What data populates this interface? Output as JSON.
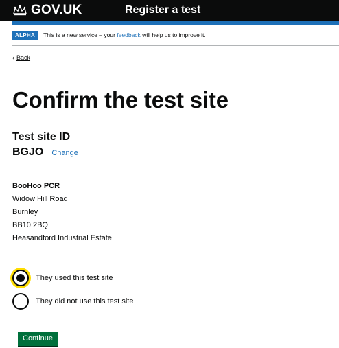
{
  "header": {
    "brand": "GOV.UK",
    "service_name": "Register a test"
  },
  "phase_banner": {
    "tag": "ALPHA",
    "text_before": "This is a new service – your",
    "link": "feedback",
    "text_after": "will help us to improve it."
  },
  "back_link": {
    "label": "Back"
  },
  "page_title": "Confirm the test site",
  "test_site": {
    "id_heading": "Test site ID",
    "id_value": "BGJO",
    "change_label": "Change"
  },
  "address": {
    "name": "BooHoo PCR",
    "lines": [
      "Widow Hill Road",
      "Burnley",
      "BB10 2BQ",
      "Heasandford Industrial Estate"
    ]
  },
  "radios": [
    {
      "label": "They used this test site",
      "checked": true
    },
    {
      "label": "They did not use this test site",
      "checked": false
    }
  ],
  "continue_label": "Continue",
  "colors": {
    "header": "#0b0c0c",
    "brand_blue": "#1d70b8",
    "button_green": "#00703c",
    "focus_yellow": "#ffdd00"
  }
}
